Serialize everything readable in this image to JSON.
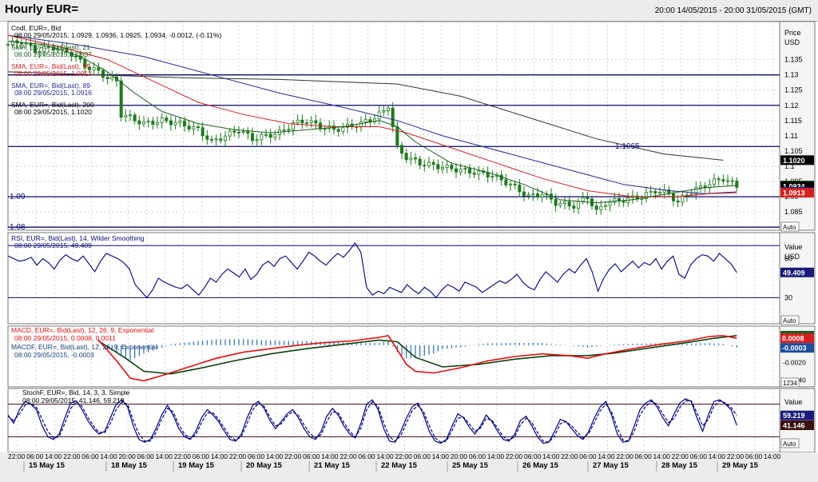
{
  "header": {
    "title": "Hourly EUR=",
    "range": "20:00 14/05/2015 - 20:00 31/05/2015 (GMT)"
  },
  "colors": {
    "candle": "#1e7a1e",
    "sma21": "#1f5f1f",
    "sma55": "#d42020",
    "sma89": "#2a2a8c",
    "sma200": "#333333",
    "hline": "#0a0a6e",
    "rsi": "#000080",
    "macd": "#e01010",
    "macdsignal": "#0f3f0f",
    "macdhist": "#2a6fb0",
    "stoch_k": "#000080",
    "stoch_d": "#000080"
  },
  "chart_data": [
    {
      "type": "candlestick",
      "panel": "price",
      "legend": [
        {
          "name": "Cndl, EUR=, Bid",
          "value": "08:00 29/05/2015, 1.0929, 1.0936, 1.0925, 1.0934, -0.0012, (-0.11%)"
        },
        {
          "name": "SMA, EUR=, Bid(Last), 21",
          "value": "08:00 29/05/2015, 1.0937"
        },
        {
          "name": "SMA, EUR=, Bid(Last), 55",
          "value": "08:00 29/05/2015, 1.0913"
        },
        {
          "name": "SMA, EUR=, Bid(Last), 89",
          "value": "08:00 29/05/2015, 1.0916"
        },
        {
          "name": "SMA, EUR=, Bid(Last), 200",
          "value": "08:00 29/05/2015, 1.1020"
        }
      ],
      "ylabel": "Price",
      "yunit": "USD",
      "ylim": [
        1.079,
        1.1475
      ],
      "ticks": [
        "1.135",
        "1.13",
        "1.125",
        "1.12",
        "1.115",
        "1.11",
        "1.105",
        "1.1",
        "1.095",
        "1.09",
        "1.085"
      ],
      "tick_values": [
        1.135,
        1.13,
        1.125,
        1.12,
        1.115,
        1.11,
        1.105,
        1.1,
        1.095,
        1.09,
        1.085
      ],
      "hlines": [
        {
          "value": 1.13,
          "label": ""
        },
        {
          "value": 1.12,
          "label": ""
        },
        {
          "value": 1.1065,
          "label": "1.1065"
        },
        {
          "value": 1.09,
          "label": "1.09"
        },
        {
          "value": 1.08,
          "label": "1.08"
        }
      ],
      "price_tags": [
        {
          "value": 1.102,
          "label": "1.1020",
          "bg": "#000000"
        },
        {
          "value": 1.0937,
          "label": "1.0937",
          "bg": "#1e5b1e"
        },
        {
          "value": 1.0934,
          "label": "1.0934",
          "bg": "#000000"
        },
        {
          "value": 1.0916,
          "label": "1.0916",
          "bg": "#1a1a7a"
        },
        {
          "value": 1.0913,
          "label": "1.0913",
          "bg": "#d42020"
        }
      ],
      "close_path": [
        [
          0,
          1.14
        ],
        [
          3,
          1.141
        ],
        [
          6,
          1.138
        ],
        [
          10,
          1.139
        ],
        [
          14,
          1.137
        ],
        [
          17,
          1.133
        ],
        [
          20,
          1.131
        ],
        [
          22,
          1.129
        ],
        [
          24,
          1.128
        ],
        [
          25,
          1.117
        ],
        [
          27,
          1.116
        ],
        [
          30,
          1.114
        ],
        [
          34,
          1.115
        ],
        [
          38,
          1.114
        ],
        [
          42,
          1.112
        ],
        [
          45,
          1.108
        ],
        [
          48,
          1.11
        ],
        [
          51,
          1.112
        ],
        [
          54,
          1.109
        ],
        [
          57,
          1.11
        ],
        [
          60,
          1.111
        ],
        [
          63,
          1.114
        ],
        [
          66,
          1.115
        ],
        [
          69,
          1.113
        ],
        [
          72,
          1.112
        ],
        [
          75,
          1.113
        ],
        [
          78,
          1.114
        ],
        [
          81,
          1.116
        ],
        [
          83,
          1.118
        ],
        [
          84,
          1.12
        ],
        [
          86,
          1.106
        ],
        [
          88,
          1.103
        ],
        [
          91,
          1.101
        ],
        [
          95,
          1.1
        ],
        [
          99,
          1.099
        ],
        [
          103,
          1.098
        ],
        [
          107,
          1.097
        ],
        [
          111,
          1.094
        ],
        [
          115,
          1.09
        ],
        [
          118,
          1.091
        ],
        [
          121,
          1.088
        ],
        [
          125,
          1.087
        ],
        [
          128,
          1.09
        ],
        [
          130,
          1.085
        ],
        [
          132,
          1.088
        ],
        [
          136,
          1.089
        ],
        [
          140,
          1.09
        ],
        [
          143,
          1.092
        ],
        [
          146,
          1.091
        ],
        [
          148,
          1.088
        ],
        [
          150,
          1.091
        ],
        [
          153,
          1.093
        ],
        [
          156,
          1.095
        ],
        [
          158,
          1.096
        ],
        [
          161,
          1.0934
        ]
      ],
      "sma21_path": [
        [
          0,
          1.141
        ],
        [
          8,
          1.14
        ],
        [
          16,
          1.136
        ],
        [
          22,
          1.131
        ],
        [
          28,
          1.124
        ],
        [
          34,
          1.118
        ],
        [
          42,
          1.114
        ],
        [
          50,
          1.112
        ],
        [
          58,
          1.111
        ],
        [
          66,
          1.112
        ],
        [
          74,
          1.113
        ],
        [
          82,
          1.115
        ],
        [
          86,
          1.113
        ],
        [
          90,
          1.108
        ],
        [
          98,
          1.101
        ],
        [
          106,
          1.098
        ],
        [
          114,
          1.094
        ],
        [
          122,
          1.089
        ],
        [
          130,
          1.088
        ],
        [
          138,
          1.089
        ],
        [
          146,
          1.091
        ],
        [
          154,
          1.093
        ],
        [
          161,
          1.0937
        ]
      ],
      "sma55_path": [
        [
          0,
          1.143
        ],
        [
          12,
          1.139
        ],
        [
          22,
          1.135
        ],
        [
          32,
          1.128
        ],
        [
          42,
          1.121
        ],
        [
          52,
          1.117
        ],
        [
          62,
          1.114
        ],
        [
          72,
          1.113
        ],
        [
          82,
          1.113
        ],
        [
          88,
          1.111
        ],
        [
          98,
          1.106
        ],
        [
          108,
          1.101
        ],
        [
          118,
          1.096
        ],
        [
          128,
          1.092
        ],
        [
          138,
          1.09
        ],
        [
          148,
          1.09
        ],
        [
          155,
          1.091
        ],
        [
          161,
          1.0913
        ]
      ],
      "sma89_path": [
        [
          0,
          1.143
        ],
        [
          15,
          1.14
        ],
        [
          30,
          1.136
        ],
        [
          45,
          1.13
        ],
        [
          60,
          1.124
        ],
        [
          75,
          1.119
        ],
        [
          86,
          1.115
        ],
        [
          96,
          1.11
        ],
        [
          106,
          1.106
        ],
        [
          116,
          1.102
        ],
        [
          126,
          1.098
        ],
        [
          136,
          1.094
        ],
        [
          146,
          1.092
        ],
        [
          154,
          1.091
        ],
        [
          161,
          1.0916
        ]
      ],
      "sma200_path": [
        [
          0,
          1.131
        ],
        [
          20,
          1.13
        ],
        [
          40,
          1.129
        ],
        [
          60,
          1.1285
        ],
        [
          86,
          1.127
        ],
        [
          100,
          1.123
        ],
        [
          115,
          1.116
        ],
        [
          130,
          1.109
        ],
        [
          145,
          1.104
        ],
        [
          158,
          1.102
        ]
      ]
    },
    {
      "type": "line",
      "panel": "rsi",
      "legend": [
        {
          "name": "RSI, EUR=, Bid(Last), 14, Wilder Smoothing",
          "value": "08:00 29/05/2015, 49.409"
        }
      ],
      "ylabel": "Value",
      "yunit": "USD",
      "ylim": [
        10,
        80
      ],
      "hlines": [
        {
          "value": 70,
          "label": ""
        },
        {
          "value": 30,
          "label": ""
        }
      ],
      "ticks": [
        "60",
        "30"
      ],
      "tick_values": [
        60,
        30
      ],
      "price_tag": "49.409",
      "values": [
        62,
        60,
        58,
        59,
        61,
        55,
        60,
        57,
        52,
        59,
        63,
        60,
        58,
        62,
        56,
        50,
        58,
        64,
        62,
        60,
        57,
        52,
        40,
        35,
        30,
        36,
        45,
        42,
        40,
        38,
        37,
        40,
        36,
        32,
        38,
        45,
        42,
        48,
        52,
        49,
        46,
        52,
        44,
        48,
        55,
        58,
        54,
        60,
        62,
        57,
        52,
        58,
        65,
        62,
        58,
        55,
        60,
        64,
        61,
        66,
        72,
        65,
        38,
        32,
        35,
        33,
        38,
        36,
        34,
        40,
        36,
        33,
        38,
        35,
        30,
        36,
        40,
        38,
        35,
        42,
        40,
        38,
        34,
        37,
        40,
        43,
        41,
        44,
        48,
        42,
        38,
        36,
        44,
        50,
        46,
        42,
        48,
        52,
        49,
        55,
        60,
        50,
        35,
        45,
        52,
        56,
        50,
        54,
        58,
        53,
        57,
        55,
        60,
        52,
        58,
        62,
        48,
        45,
        55,
        60,
        63,
        62,
        58,
        64,
        60,
        56,
        49.409
      ]
    },
    {
      "type": "line",
      "panel": "macd",
      "legend": [
        {
          "name": "MACD, EUR=, Bid(Last), 12, 26, 9, Exponential",
          "value": "08:00 29/05/2015, 0.0008, 0.0011"
        },
        {
          "name": "MACDF, EUR=, Bid(Last), 12, 26, 9, Exponential",
          "value": "08:00 29/05/2015, -0.0003"
        }
      ],
      "ylim": [
        -0.0048,
        0.0022
      ],
      "ticks": [
        "-0.0020",
        "-0.0040"
      ],
      "tick_values": [
        -0.002,
        -0.004
      ],
      "price_tags": [
        {
          "value": 0.0011,
          "label": "0.0011",
          "bg": "#1e5b1e"
        },
        {
          "value": 0.0008,
          "label": "0.0008",
          "bg": "#d42020"
        },
        {
          "value": -0.0003,
          "label": "-0.0003",
          "bg": "#1a4f9a"
        }
      ],
      "badge": "1234",
      "macd_path": [
        [
          20,
          0.0006
        ],
        [
          24,
          -0.0018
        ],
        [
          27,
          -0.0038
        ],
        [
          30,
          -0.0041
        ],
        [
          34,
          -0.0035
        ],
        [
          40,
          -0.0025
        ],
        [
          46,
          -0.0015
        ],
        [
          52,
          -0.0008
        ],
        [
          58,
          -0.0004
        ],
        [
          64,
          0.0
        ],
        [
          70,
          0.0003
        ],
        [
          76,
          0.0005
        ],
        [
          82,
          0.0009
        ],
        [
          84,
          0.0011
        ],
        [
          86,
          -0.0005
        ],
        [
          88,
          -0.0022
        ],
        [
          90,
          -0.003
        ],
        [
          94,
          -0.0032
        ],
        [
          100,
          -0.0026
        ],
        [
          106,
          -0.0018
        ],
        [
          112,
          -0.0013
        ],
        [
          118,
          -0.001
        ],
        [
          124,
          -0.0012
        ],
        [
          128,
          -0.0015
        ],
        [
          132,
          -0.001
        ],
        [
          138,
          -0.0004
        ],
        [
          144,
          0.0001
        ],
        [
          150,
          0.0005
        ],
        [
          155,
          0.001
        ],
        [
          158,
          0.0011
        ],
        [
          161,
          0.0008
        ]
      ],
      "signal_path": [
        [
          20,
          0.0005
        ],
        [
          26,
          -0.0015
        ],
        [
          30,
          -0.003
        ],
        [
          36,
          -0.0033
        ],
        [
          42,
          -0.0027
        ],
        [
          50,
          -0.0018
        ],
        [
          58,
          -0.001
        ],
        [
          66,
          -0.0004
        ],
        [
          74,
          0.0001
        ],
        [
          82,
          0.0006
        ],
        [
          86,
          0.0004
        ],
        [
          90,
          -0.0014
        ],
        [
          96,
          -0.0025
        ],
        [
          104,
          -0.0022
        ],
        [
          112,
          -0.0016
        ],
        [
          120,
          -0.0012
        ],
        [
          128,
          -0.0012
        ],
        [
          134,
          -0.0009
        ],
        [
          142,
          -0.0003
        ],
        [
          150,
          0.0003
        ],
        [
          156,
          0.0008
        ],
        [
          161,
          0.0011
        ]
      ]
    },
    {
      "type": "line",
      "panel": "stochastic",
      "legend": [
        {
          "name": "StochF, EUR=, Bid, 14, 3, 3, Simple",
          "value": "08:00 29/05/2015, 41.146, 59.219"
        }
      ],
      "ylabel": "Value",
      "ylim": [
        0,
        100
      ],
      "hlines": [
        {
          "value": 80,
          "label": ""
        },
        {
          "value": 20,
          "label": ""
        }
      ],
      "price_tags": [
        {
          "value": 59.219,
          "label": "59.219",
          "bg": "#1a1a7a"
        },
        {
          "value": 41.146,
          "label": "41.146",
          "bg": "#3a0f0f"
        }
      ],
      "k_values": [
        60,
        45,
        70,
        85,
        80,
        70,
        40,
        20,
        15,
        25,
        55,
        82,
        86,
        70,
        50,
        35,
        25,
        30,
        55,
        80,
        88,
        75,
        40,
        15,
        10,
        15,
        35,
        60,
        78,
        60,
        35,
        20,
        15,
        30,
        55,
        70,
        60,
        48,
        30,
        15,
        12,
        25,
        55,
        78,
        85,
        72,
        50,
        35,
        48,
        62,
        70,
        55,
        35,
        20,
        15,
        30,
        58,
        72,
        60,
        40,
        25,
        18,
        45,
        80,
        88,
        70,
        35,
        12,
        10,
        30,
        55,
        75,
        82,
        60,
        30,
        12,
        8,
        15,
        40,
        62,
        55,
        38,
        25,
        40,
        60,
        48,
        30,
        15,
        12,
        25,
        50,
        58,
        40,
        20,
        8,
        10,
        30,
        52,
        48,
        35,
        22,
        15,
        30,
        55,
        75,
        85,
        60,
        25,
        10,
        12,
        40,
        70,
        82,
        88,
        75,
        55,
        40,
        62,
        82,
        90,
        85,
        55,
        30,
        60,
        85,
        88,
        80,
        70,
        41.146
      ],
      "d_values": [
        58,
        50,
        62,
        78,
        82,
        74,
        52,
        30,
        18,
        20,
        45,
        72,
        84,
        76,
        56,
        40,
        28,
        28,
        45,
        70,
        84,
        80,
        50,
        25,
        12,
        12,
        28,
        52,
        72,
        66,
        42,
        25,
        16,
        24,
        46,
        64,
        64,
        52,
        36,
        20,
        14,
        20,
        45,
        70,
        82,
        76,
        56,
        40,
        44,
        58,
        66,
        60,
        42,
        26,
        18,
        24,
        48,
        66,
        64,
        46,
        30,
        20,
        36,
        70,
        84,
        76,
        45,
        20,
        12,
        22,
        46,
        68,
        78,
        66,
        40,
        18,
        10,
        12,
        32,
        54,
        56,
        44,
        30,
        36,
        54,
        50,
        36,
        20,
        14,
        20,
        42,
        54,
        46,
        28,
        12,
        10,
        22,
        44,
        48,
        40,
        28,
        18,
        26,
        46,
        68,
        80,
        66,
        36,
        14,
        12,
        30,
        60,
        76,
        85,
        80,
        62,
        46,
        54,
        74,
        86,
        86,
        64,
        40,
        52,
        76,
        86,
        82,
        74,
        59.219
      ]
    }
  ],
  "xaxis": {
    "time_labels": [
      "22:00",
      "06:00",
      "14:00",
      "22:00",
      "06:00",
      "14:00",
      "20:00",
      "06:00",
      "14:00",
      "22:00",
      "06:00",
      "14:00",
      "22:00",
      "06:00",
      "14:00",
      "22:00",
      "06:00",
      "14:00",
      "22:00",
      "06:00",
      "14:00",
      "22:00",
      "06:00",
      "14:00",
      "20:00",
      "06:00",
      "14:00",
      "22:00",
      "06:00",
      "14:00",
      "22:00",
      "06:00",
      "14:00",
      "22:00",
      "06:00",
      "14:00",
      "22:00",
      "06:00",
      "14:00",
      "22:00",
      "06:00",
      "14:00"
    ],
    "date_labels": [
      "15 May 15",
      "18 May 15",
      "19 May 15",
      "20 May 15",
      "21 May 15",
      "22 May 15",
      "25 May 15",
      "26 May 15",
      "27 May 15",
      "28 May 15",
      "29 May 15"
    ]
  },
  "buttons": {
    "auto": "Auto"
  }
}
